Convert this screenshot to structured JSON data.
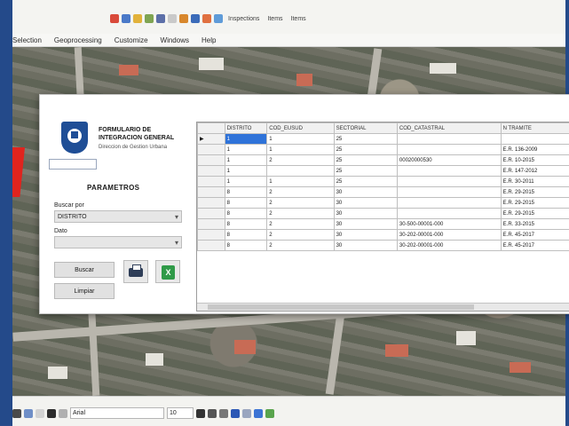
{
  "menubar": [
    "Selection",
    "Geoprocessing",
    "Customize",
    "Windows",
    "Help"
  ],
  "toolbar": {
    "inspections": "Inspections",
    "items_a": "Items",
    "items_b": "Items"
  },
  "dialog": {
    "org_title": "FORMULARIO DE INTEGRACION GENERAL",
    "org_subtitle": "Direccion de Gestion Urbana",
    "params_title": "PARAMETROS",
    "buscar_label": "Buscar por",
    "buscar_value": "DISTRITO",
    "dato_label": "Dato",
    "dato_value": "",
    "buscar_button": "Buscar",
    "limpiar_button": "Limpiar",
    "excel_icon": "excel-icon",
    "print_icon": "printer-icon"
  },
  "grid": {
    "columns": [
      "DISTRITO",
      "COD_EUSUD",
      "SECTORIAL",
      "COD_CATASTRAL",
      "N TRAMITE"
    ],
    "rows": [
      [
        "1",
        "1",
        "25",
        "",
        ""
      ],
      [
        "1",
        "1",
        "25",
        "",
        "E.R. 136-2009"
      ],
      [
        "1",
        "2",
        "25",
        "00020000530",
        "E.R. 10-2015"
      ],
      [
        "1",
        "",
        "25",
        "",
        "E.R. 147-2012"
      ],
      [
        "1",
        "1",
        "25",
        "",
        "E.R. 30-2011"
      ],
      [
        "8",
        "2",
        "30",
        "",
        "E.R. 29-2015"
      ],
      [
        "8",
        "2",
        "30",
        "",
        "E.R. 29-2015"
      ],
      [
        "8",
        "2",
        "30",
        "",
        "E.R. 29-2015"
      ],
      [
        "8",
        "2",
        "30",
        "30-500-00001-000",
        "E.R. 33-2015"
      ],
      [
        "8",
        "2",
        "30",
        "30-202-00001-000",
        "E.R. 45-2017"
      ],
      [
        "8",
        "2",
        "30",
        "30-202-00001-000",
        "E.R. 45-2017"
      ]
    ]
  },
  "bottombar": {
    "font": "Arial",
    "size": "10"
  }
}
